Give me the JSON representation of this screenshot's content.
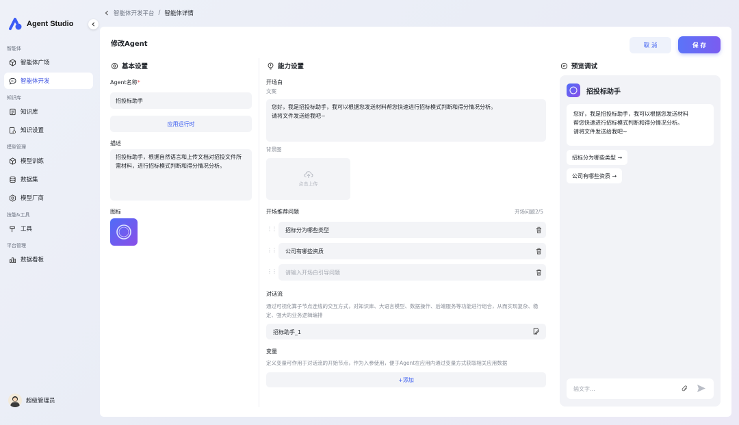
{
  "app": {
    "name": "Agent Studio"
  },
  "breadcrumb": {
    "parent": "智能体开发平台",
    "separator": "/",
    "current": "智能体详情"
  },
  "sidebar": {
    "sections": [
      {
        "label": "智能体",
        "items": [
          {
            "label": "智能体广场",
            "icon": "cube-icon"
          },
          {
            "label": "智能体开发",
            "icon": "chat-icon",
            "active": true
          }
        ]
      },
      {
        "label": "知识库",
        "items": [
          {
            "label": "知识库",
            "icon": "doc-icon"
          },
          {
            "label": "知识设置",
            "icon": "doc-settings-icon"
          }
        ]
      },
      {
        "label": "模型管理",
        "items": [
          {
            "label": "模型训练",
            "icon": "cube-icon"
          },
          {
            "label": "数据集",
            "icon": "database-icon"
          },
          {
            "label": "模型厂商",
            "icon": "vendor-icon"
          }
        ]
      },
      {
        "label": "技能&工具",
        "items": [
          {
            "label": "工具",
            "icon": "hammer-icon"
          }
        ]
      },
      {
        "label": "平台管理",
        "items": [
          {
            "label": "数据看板",
            "icon": "bar-chart-icon"
          }
        ]
      }
    ],
    "user": {
      "name": "超级管理员"
    }
  },
  "page": {
    "title": "修改Agent",
    "cancel_label": "取 消",
    "save_label": "保 存"
  },
  "basic": {
    "title": "基本设置",
    "name_label": "Agent名称",
    "required_mark": "*",
    "name_value": "招投标助手",
    "runtime_button": "应用运行时",
    "desc_label": "描述",
    "desc_value": "招投标助手，根据自然语言和上传文档对招投文件所需材料，进行招标模式判断和得分情况分析。",
    "icon_label": "图标"
  },
  "ability": {
    "title": "能力设置",
    "opening_label": "开场白",
    "copy_label": "文案",
    "opening_text_1": "您好，我是招投标助手，我可以根据您发送材料帮您快速进行招标模式判断和得分情况分析。",
    "opening_text_2": "请将文件发送给我吧~",
    "bg_label": "背景图",
    "upload_label": "点击上传",
    "questions_label": "开场推荐问题",
    "questions_count": "开场问题2/5",
    "questions": [
      "招标分为哪些类型",
      "公司有哪些资质"
    ],
    "question_placeholder": "请输入开场白引导问题",
    "flow_label": "对话流",
    "flow_desc": "通过可视化算子节点连线的交互方式，对知识库、大语言模型、数据操作、后端服务等功能进行组合，从而实现复杂、稳定、强大的业务逻辑编排",
    "flow_value": "招标助手_1",
    "var_label": "变量",
    "var_desc": "定义变量可作用于对话流的开始节点，作为入参使用，便于Agent在应用内通过变量方式获取相关应用数据",
    "add_label": "+添加"
  },
  "preview": {
    "title": "预览调试",
    "agent_name": "招投标助手",
    "greeting_1": "您好，我是招投标助手，我可以根据您发送材料",
    "greeting_2": "帮您快速进行招标模式判断和得分情况分析。",
    "greeting_3": "请将文件发送给我吧~",
    "suggestions": [
      "招标分为哪些类型 →",
      "公司有哪些资质 →"
    ],
    "input_placeholder": "输文字..."
  },
  "colors": {
    "accent": "#3a5cf0",
    "save_gradient_start": "#5b74f8",
    "save_gradient_end": "#7b5cf0",
    "required": "#f04f4f"
  }
}
